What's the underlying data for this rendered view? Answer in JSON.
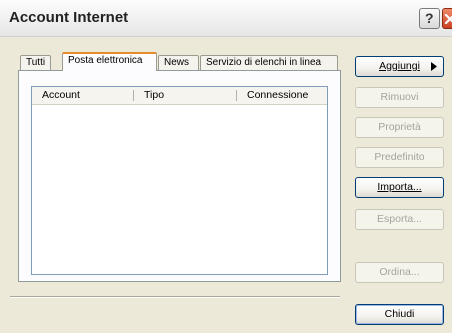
{
  "window": {
    "title": "Account Internet"
  },
  "titlebar": {
    "help_glyph": "?"
  },
  "tabs": [
    {
      "label": "Tutti"
    },
    {
      "label": "Posta elettronica"
    },
    {
      "label": "News"
    },
    {
      "label": "Servizio di elenchi in linea"
    }
  ],
  "list": {
    "columns": [
      "Account",
      "Tipo",
      "Connessione"
    ],
    "rows": []
  },
  "buttons": {
    "add": "Aggiungi",
    "remove": "Rimuovi",
    "properties": "Proprietà",
    "default": "Predefinito",
    "import": "Importa...",
    "export": "Esporta...",
    "order": "Ordina...",
    "close": "Chiudi"
  },
  "colors": {
    "tab_accent": "#e68b2c",
    "dialog_bg": "#ece9d8",
    "close_button": "#c94124"
  }
}
